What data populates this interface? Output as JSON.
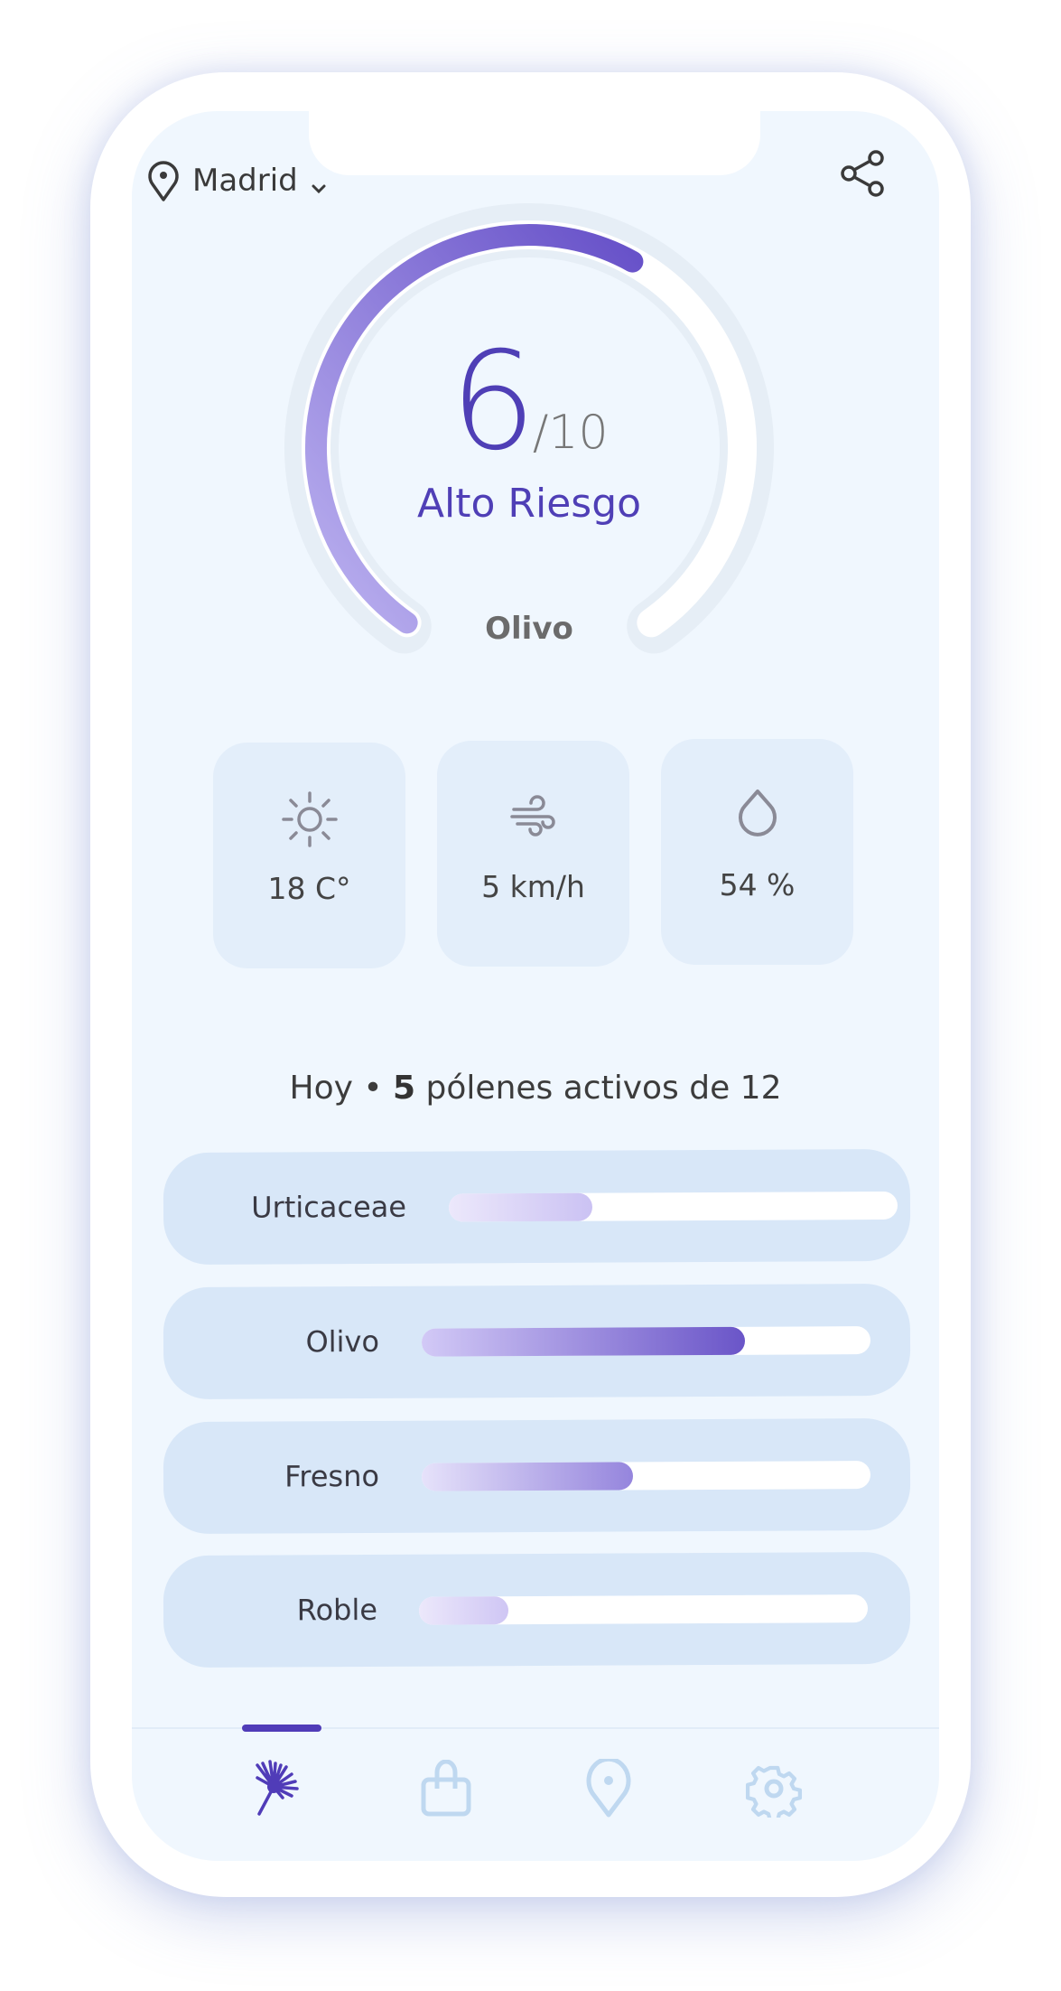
{
  "header": {
    "location": "Madrid",
    "location_icon": "map-pin-icon",
    "dropdown_icon": "chevron-down-icon",
    "share_icon": "share-icon"
  },
  "gauge": {
    "score": "6",
    "max": "/10",
    "score_value": 6,
    "max_value": 10,
    "risk_label": "Alto Riesgo",
    "pollen": "Olivo",
    "color": "#4f3fb6"
  },
  "weather": [
    {
      "icon": "sun-icon",
      "value": "18 C°"
    },
    {
      "icon": "wind-icon",
      "value": "5 km/h"
    },
    {
      "icon": "drop-icon",
      "value": "54 %"
    }
  ],
  "summary": {
    "prefix": "Hoy •",
    "count": "5",
    "suffix": "pólenes activos de 12"
  },
  "pollens": [
    {
      "name": "Urticaceae",
      "level": 0.32
    },
    {
      "name": "Olivo",
      "level": 0.72
    },
    {
      "name": "Fresno",
      "level": 0.47
    },
    {
      "name": "Roble",
      "level": 0.2
    }
  ],
  "nav": [
    {
      "icon": "dandelion-icon",
      "active": true
    },
    {
      "icon": "shopping-bag-icon",
      "active": false
    },
    {
      "icon": "map-pin-icon",
      "active": false
    },
    {
      "icon": "gear-icon",
      "active": false
    }
  ],
  "colors": {
    "accent": "#503cb8",
    "inactive": "#bfd8f0",
    "card": "#e3eefa",
    "row": "#d8e7f8"
  }
}
